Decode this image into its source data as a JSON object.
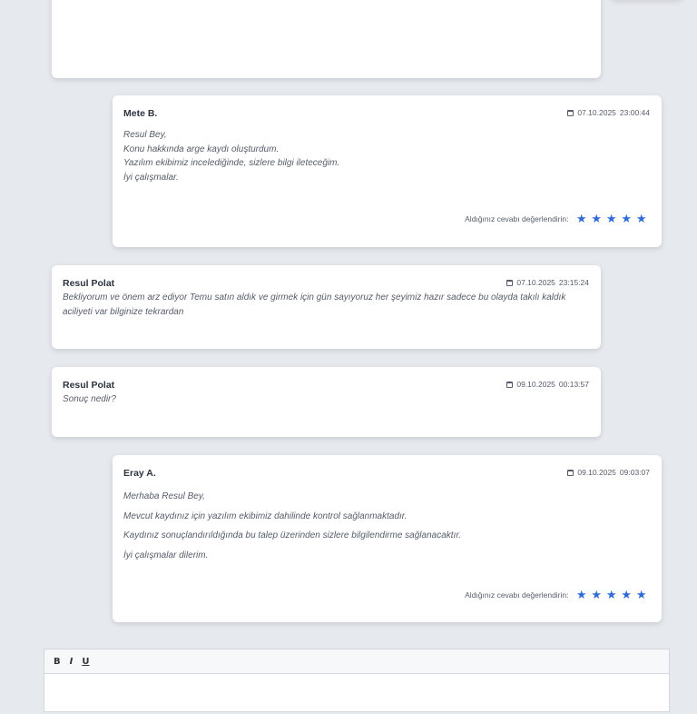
{
  "messages": [
    {
      "author": "Mete B.",
      "date": "07.10.2025",
      "time": "23:00:44",
      "lines": [
        "Resul Bey,",
        "Konu hakkında arge kaydı oluşturdum.",
        "Yazılım ekibimiz incelediğinde, sizlere bilgi ileteceğim.",
        "İyi çalışmalar."
      ],
      "rating_label": "Aldığınız cevabı değerlendirin:",
      "stars": 5
    },
    {
      "author": "Resul Polat",
      "date": "07.10.2025",
      "time": "23:15:24",
      "lines": [
        "Bekliyorum ve önem arz ediyor Temu satın aldık ve girmek için gün sayıyoruz her şeyimiz hazır sadece bu olayda takılı kaldık aciliyeti var bilginize tekrardan"
      ]
    },
    {
      "author": "Resul Polat",
      "date": "09.10.2025",
      "time": "00:13:57",
      "lines": [
        "Sonuç nedir?"
      ]
    },
    {
      "author": "Eray A.",
      "date": "09.10.2025",
      "time": "09:03:07",
      "lines": [
        "Merhaba Resul Bey,",
        "Mevcut kaydınız için yazılım ekibimiz dahilinde kontrol sağlanmaktadır.",
        "Kaydınız sonuçlandırıldığında bu talep üzerinden sizlere bilgilendirme sağlanacaktır.",
        "İyi çalışmalar dilerim."
      ],
      "rating_label": "Aldığınız cevabı değerlendirin:",
      "stars": 5
    }
  ],
  "editor": {
    "bold": "B",
    "italic": "I",
    "underline": "U"
  },
  "colors": {
    "accent": "#2f6bd6",
    "background": "#e6e9ee"
  }
}
